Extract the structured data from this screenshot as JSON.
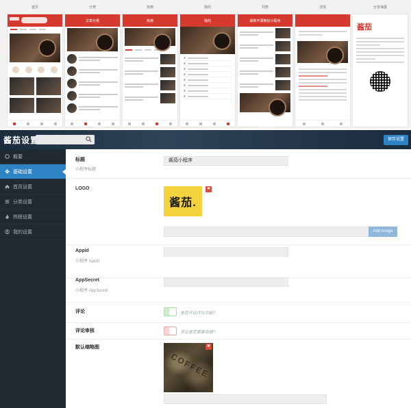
{
  "previews": {
    "captions": [
      "首页",
      "分类",
      "热榜",
      "我的",
      "列表",
      "详情",
      "分享海报"
    ],
    "screen_titles": [
      "",
      "文章分类",
      "热榜",
      "我的",
      "最新开源微信小程序",
      "",
      ""
    ],
    "brand": "酱茄"
  },
  "app": {
    "title": "酱茄设置"
  },
  "toolbar": {
    "save_label": "保存设置"
  },
  "sidebar": {
    "items": [
      {
        "label": "概要",
        "icon": "circle-icon"
      },
      {
        "label": "基础设置",
        "icon": "gear-icon"
      },
      {
        "label": "首页设置",
        "icon": "home-icon"
      },
      {
        "label": "分类设置",
        "icon": "list-icon"
      },
      {
        "label": "热榜设置",
        "icon": "fire-icon"
      },
      {
        "label": "我的设置",
        "icon": "user-icon"
      }
    ],
    "active_index": 1
  },
  "form": {
    "title": {
      "label": "标题",
      "sub": "小程序标题",
      "value": "酱茄小程序"
    },
    "logo": {
      "label": "LOGO",
      "image_text": "酱茄.",
      "delete_mark": "✖",
      "add_label": "Add Image"
    },
    "appid": {
      "label": "Appid",
      "sub": "小程序 Appid",
      "value": ""
    },
    "appsecret": {
      "label": "AppSecret",
      "sub": "小程序 AppSecret",
      "value": ""
    },
    "comment": {
      "label": "评论",
      "hint": "是否开启评论功能?",
      "toggle_color": "#a6e3a6"
    },
    "comment_review": {
      "label": "评论审核",
      "hint": "评论是否需要审核?",
      "toggle_color": "#f2a3a3"
    },
    "default_thumb": {
      "label": "默认缩略图",
      "image_text": "COFFEE",
      "delete_mark": "✖"
    }
  },
  "colors": {
    "accent": "#2d83c4",
    "brand_red": "#d63a2f",
    "sidebar_bg": "#1f2a33"
  }
}
